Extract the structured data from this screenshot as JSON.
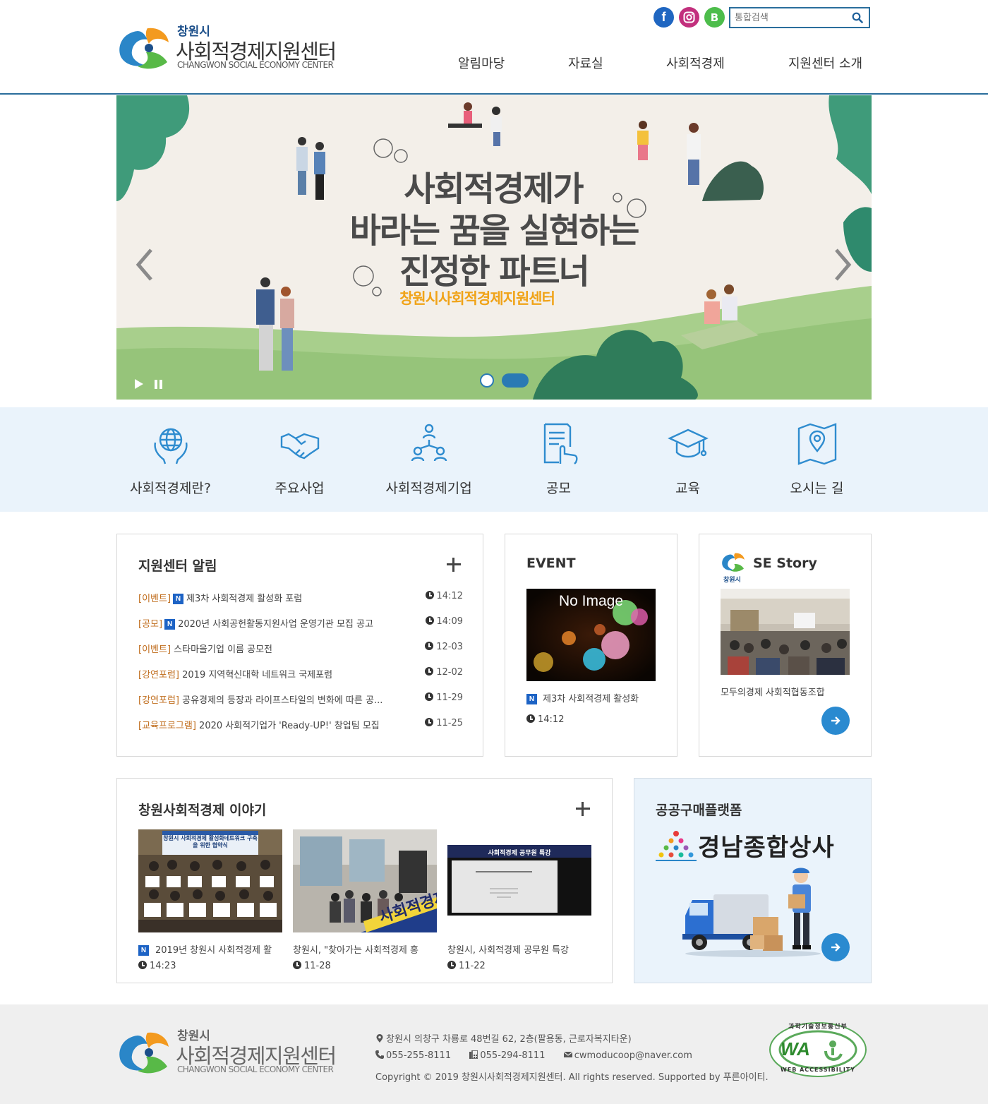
{
  "header": {
    "logo": {
      "small": "창원시",
      "big": "사회적경제지원센터",
      "en": "CHANGWON SOCIAL ECONOMY CENTER"
    },
    "social": [
      {
        "name": "facebook-icon",
        "glyph": "f"
      },
      {
        "name": "instagram-icon",
        "glyph": ""
      },
      {
        "name": "blog-icon",
        "glyph": "B"
      }
    ],
    "search": {
      "placeholder": "통합검색"
    },
    "nav": [
      "알림마당",
      "자료실",
      "사회적경제",
      "지원센터 소개"
    ]
  },
  "banner": {
    "line1": "사회적경제가",
    "line2": "바라는 꿈을 실현하는",
    "line3": "진정한 파트너",
    "sub": "창원시사회적경제지원센터"
  },
  "quick_menu": [
    {
      "label": "사회적경제란?",
      "icon": "globe-hands-icon"
    },
    {
      "label": "주요사업",
      "icon": "handshake-icon"
    },
    {
      "label": "사회적경제기업",
      "icon": "network-people-icon"
    },
    {
      "label": "공모",
      "icon": "document-hand-icon"
    },
    {
      "label": "교육",
      "icon": "graduation-cap-icon"
    },
    {
      "label": "오시는 길",
      "icon": "map-pin-icon"
    }
  ],
  "notice": {
    "title": "지원센터 알림",
    "items": [
      {
        "category": "[이벤트]",
        "new": true,
        "title": "제3차 사회적경제 활성화 포럼",
        "time": "14:12"
      },
      {
        "category": "[공모]",
        "new": true,
        "title": "2020년 사회공헌활동지원사업 운영기관 모집 공고",
        "time": "14:09"
      },
      {
        "category": "[이벤트]",
        "new": false,
        "title": "스타마을기업 이름 공모전",
        "time": "12-03"
      },
      {
        "category": "[강연포럼]",
        "new": false,
        "title": "2019 지역혁신대학 네트워크 국제포럼",
        "time": "12-02"
      },
      {
        "category": "[강연포럼]",
        "new": false,
        "title": "공유경제의 등장과 라이프스타일의 변화에 따른 공...",
        "time": "11-29"
      },
      {
        "category": "[교육프로그램]",
        "new": false,
        "title": "2020 사회적기업가 'Ready-UP!' 창업팀 모집",
        "time": "11-25"
      }
    ],
    "new_badge": "N"
  },
  "event": {
    "title": "EVENT",
    "image_text": "No Image",
    "caption": "제3차 사회적경제 활성화",
    "time": "14:12"
  },
  "se_story": {
    "title": "SE Story",
    "logo_text": "창원시",
    "caption": "모두의경제 사회적협동조합"
  },
  "stories": {
    "title": "창원사회적경제 이야기",
    "items": [
      {
        "caption": "2019년 창원시 사회적경제 활",
        "time": "14:23",
        "new": true,
        "banner": "창원시 사회적경제 활성화네트워크 구축을 위한 협약식"
      },
      {
        "caption": "창원시, \"찾아가는 사회적경제 홍",
        "time": "11-28",
        "new": false,
        "banner": "사회적경제"
      },
      {
        "caption": "창원시, 사회적경제 공무원 특강",
        "time": "11-22",
        "new": false,
        "banner": "사회적경제 공무원 특강"
      }
    ]
  },
  "procurement": {
    "title": "공공구매플랫폼",
    "brand": "경남종합상사"
  },
  "footer": {
    "address": "창원시 의창구 차룡로 48번길 62, 2층(팔용동, 근로자복지타운)",
    "phone": "055-255-8111",
    "fax": "055-294-8111",
    "email": "cwmoducoop@naver.com",
    "copyright": "Copyright © 2019 창원시사회적경제지원센터. All rights reserved. Supported by 푸른아이티.",
    "wa_mark": "WA",
    "wa_top": "과학기술정보통신부",
    "wa_bottom": "WEB ACCESSIBILITY"
  },
  "colors": {
    "brand_blue": "#2a6e9c",
    "accent_blue": "#2a8ad0",
    "category_orange": "#c06d1d",
    "quick_bg": "#eaf3fb",
    "footer_bg": "#efefef"
  }
}
